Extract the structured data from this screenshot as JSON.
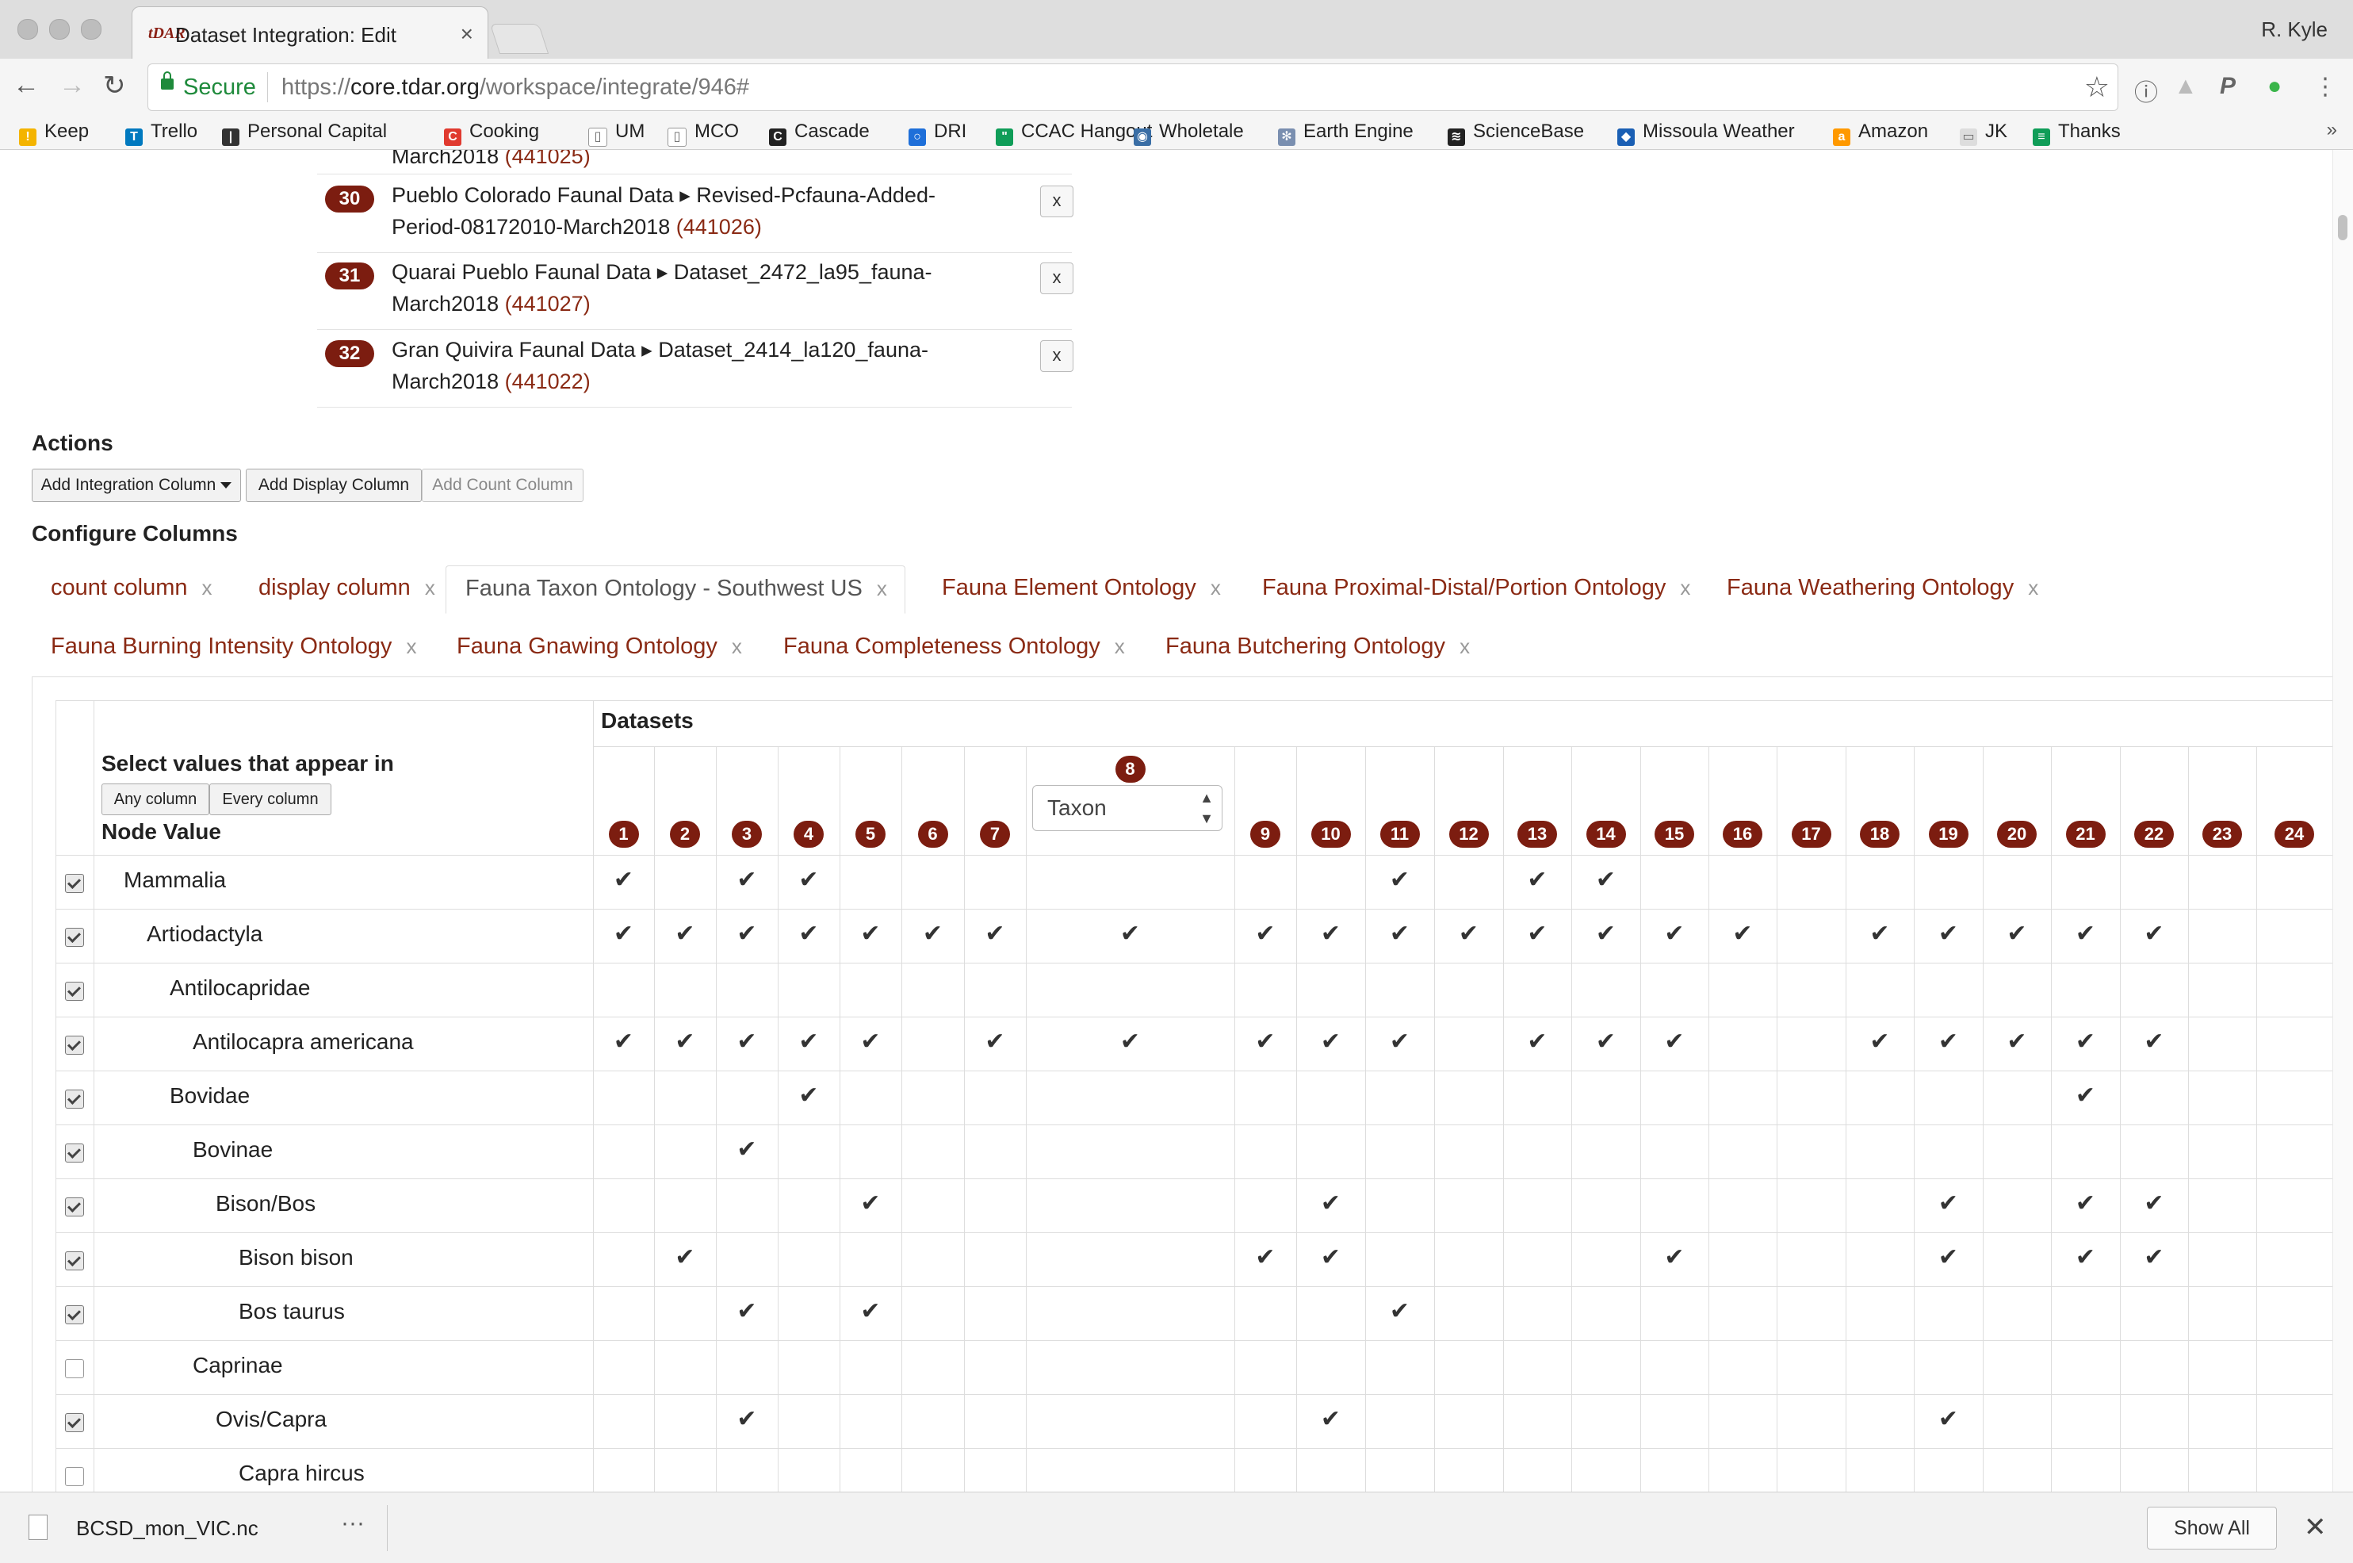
{
  "browser": {
    "tab_title": "Dataset Integration: Edit",
    "favicon_text": "tDAR",
    "user": "R. Kyle",
    "secure_label": "Secure",
    "url_scheme": "https://",
    "url_host": "core.tdar.org",
    "url_path": "/workspace/integrate/946#",
    "bookmarks": [
      {
        "label": "Keep",
        "color": "#f4b400",
        "glyph": "!"
      },
      {
        "label": "Trello",
        "color": "#0079bf",
        "glyph": "T"
      },
      {
        "label": "Personal Capital",
        "color": "#333333",
        "glyph": "|"
      },
      {
        "label": "Cooking",
        "color": "#e03a2f",
        "glyph": "C"
      },
      {
        "label": "UM",
        "color": "#ffffff",
        "glyph": "▯"
      },
      {
        "label": "MCO",
        "color": "#ffffff",
        "glyph": "▯"
      },
      {
        "label": "Cascade",
        "color": "#222222",
        "glyph": "C"
      },
      {
        "label": "DRI",
        "color": "#1e6fd9",
        "glyph": "○"
      },
      {
        "label": "CCAC Hangout",
        "color": "#0f9d58",
        "glyph": "\""
      },
      {
        "label": "Wholetale",
        "color": "#3a6ea5",
        "glyph": "◉"
      },
      {
        "label": "Earth Engine",
        "color": "#7a8fb0",
        "glyph": "✻"
      },
      {
        "label": "ScienceBase",
        "color": "#222222",
        "glyph": "≋"
      },
      {
        "label": "Missoula Weather",
        "color": "#1a5fb4",
        "glyph": "◆"
      },
      {
        "label": "Amazon",
        "color": "#ff9900",
        "glyph": "a"
      },
      {
        "label": "JK",
        "color": "#dddddd",
        "glyph": "▭"
      },
      {
        "label": "Thanks",
        "color": "#0f9d58",
        "glyph": "≡"
      }
    ]
  },
  "datasets": {
    "partial_top": {
      "text": "March2018",
      "id": "(441025)"
    },
    "items": [
      {
        "num": "30",
        "line1": "Pueblo Colorado Faunal Data ▸ Revised-Pcfauna-Added-",
        "line2": "Period-08172010-March2018",
        "id": "(441026)",
        "remove": "x"
      },
      {
        "num": "31",
        "line1": "Quarai Pueblo Faunal Data ▸ Dataset_2472_la95_fauna-",
        "line2": "March2018",
        "id": "(441027)",
        "remove": "x"
      },
      {
        "num": "32",
        "line1": "Gran Quivira Faunal Data ▸ Dataset_2414_la120_fauna-",
        "line2": "March2018",
        "id": "(441022)",
        "remove": "x"
      }
    ]
  },
  "actions": {
    "heading": "Actions",
    "add_integration": "Add Integration Column",
    "add_display": "Add Display Column",
    "add_count": "Add Count Column"
  },
  "configure": {
    "heading": "Configure Columns",
    "tabs_row1": [
      {
        "label": "count column",
        "close": "x"
      },
      {
        "label": "display column",
        "close": "x"
      },
      {
        "label": "Fauna Taxon Ontology - Southwest US",
        "close": "x",
        "active": true
      },
      {
        "label": "Fauna Element Ontology",
        "close": "x"
      },
      {
        "label": "Fauna Proximal-Distal/Portion Ontology",
        "close": "x"
      },
      {
        "label": "Fauna Weathering Ontology",
        "close": "x"
      }
    ],
    "tabs_row2": [
      {
        "label": "Fauna Burning Intensity Ontology",
        "close": "x"
      },
      {
        "label": "Fauna Gnawing Ontology",
        "close": "x"
      },
      {
        "label": "Fauna Completeness Ontology",
        "close": "x"
      },
      {
        "label": "Fauna Butchering Ontology",
        "close": "x"
      }
    ]
  },
  "table": {
    "datasets_header": "Datasets",
    "select_label": "Select values that appear in",
    "any_column": "Any column",
    "every_column": "Every column",
    "node_value_header": "Node Value",
    "taxon_select": "Taxon",
    "columns": [
      "1",
      "2",
      "3",
      "4",
      "5",
      "6",
      "7",
      "8",
      "9",
      "10",
      "11",
      "12",
      "13",
      "14",
      "15",
      "16",
      "17",
      "18",
      "19",
      "20",
      "21",
      "22",
      "23",
      "24"
    ],
    "check_glyph": "✔",
    "rows": [
      {
        "name": "Mammalia",
        "depth": 0,
        "selected": true,
        "checks": [
          1,
          3,
          4,
          11,
          13,
          14
        ]
      },
      {
        "name": "Artiodactyla",
        "depth": 1,
        "selected": true,
        "checks": [
          1,
          2,
          3,
          4,
          5,
          6,
          7,
          8,
          9,
          10,
          11,
          12,
          13,
          14,
          15,
          16,
          18,
          19,
          20,
          21,
          22
        ]
      },
      {
        "name": "Antilocapridae",
        "depth": 2,
        "selected": true,
        "checks": []
      },
      {
        "name": "Antilocapra americana",
        "depth": 3,
        "selected": true,
        "checks": [
          1,
          2,
          3,
          4,
          5,
          7,
          8,
          9,
          10,
          11,
          13,
          14,
          15,
          18,
          19,
          20,
          21,
          22
        ]
      },
      {
        "name": "Bovidae",
        "depth": 2,
        "selected": true,
        "checks": [
          4,
          21
        ]
      },
      {
        "name": "Bovinae",
        "depth": 3,
        "selected": true,
        "checks": [
          3
        ]
      },
      {
        "name": "Bison/Bos",
        "depth": 4,
        "selected": true,
        "checks": [
          5,
          10,
          19,
          21,
          22
        ]
      },
      {
        "name": "Bison bison",
        "depth": 5,
        "selected": true,
        "checks": [
          2,
          9,
          10,
          15,
          19,
          21,
          22
        ]
      },
      {
        "name": "Bos taurus",
        "depth": 5,
        "selected": true,
        "checks": [
          3,
          5,
          11
        ]
      },
      {
        "name": "Caprinae",
        "depth": 3,
        "selected": false,
        "checks": []
      },
      {
        "name": "Ovis/Capra",
        "depth": 4,
        "selected": true,
        "checks": [
          3,
          10,
          19
        ]
      },
      {
        "name": "Capra hircus",
        "depth": 5,
        "selected": false,
        "checks": []
      }
    ]
  },
  "downloads": {
    "file": "BCSD_mon_VIC.nc",
    "more": "···",
    "show_all": "Show All",
    "close": "✕"
  }
}
